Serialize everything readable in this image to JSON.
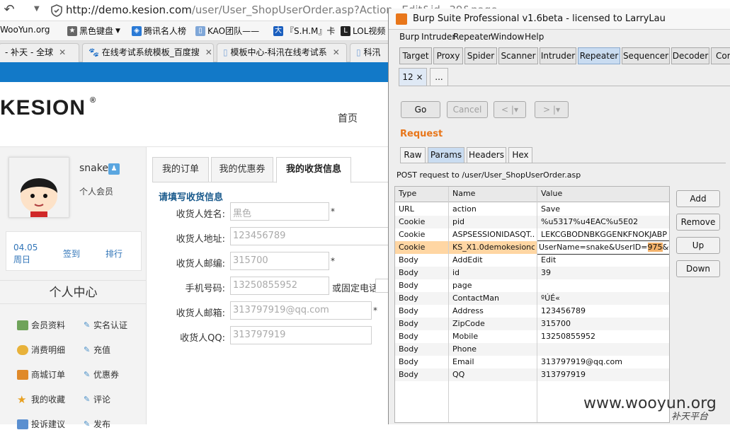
{
  "browser": {
    "url_host": "http://demo.kesion.com",
    "url_path": "/user/User_ShopUserOrder.asp?Action=Edit&id=39&page=",
    "bookmarks": [
      "WooYun.org",
      "黑色键盘",
      "腾讯名人榜",
      "KAO团队——",
      "『S.H.M』卡",
      "LOL视频"
    ],
    "tabs": [
      "- 补天 - 全球",
      "在线考试系统模板_百度搜",
      "模板中心-科汛在线考试系",
      "科汛"
    ]
  },
  "site": {
    "logo": "KESION",
    "logo_mark": "®",
    "nav_home": "首页",
    "user": {
      "name": "snake",
      "role": "个人会员"
    },
    "date": {
      "day": "04.05",
      "weekday": "周日"
    },
    "signin": "签到",
    "rank": "排行",
    "center_title": "个人中心",
    "menu": [
      {
        "left": "会员资料",
        "right": "实名认证"
      },
      {
        "left": "消费明细",
        "right": "充值"
      },
      {
        "left": "商城订单",
        "right": "优惠券"
      },
      {
        "left": "我的收藏",
        "right": "评论"
      },
      {
        "left": "投诉建议",
        "right": "发布"
      }
    ],
    "tabs": [
      "我的订单",
      "我的优惠券",
      "我的收货信息"
    ],
    "form_title": "请填写收货信息",
    "fields": [
      {
        "label": "收货人姓名:",
        "value": "黑色",
        "required": "*"
      },
      {
        "label": "收货人地址:",
        "value": "123456789",
        "required": ""
      },
      {
        "label": "收货人邮编:",
        "value": "315700",
        "required": "*"
      },
      {
        "label": "手机号码:",
        "value": "13250855952",
        "required": ""
      },
      {
        "label": "收货人邮箱:",
        "value": "313797919@qq.com",
        "required": "*"
      },
      {
        "label": "收货人QQ:",
        "value": "313797919",
        "required": ""
      }
    ],
    "phone_alt": "或固定电话"
  },
  "burp": {
    "title": "Burp Suite Professional v1.6beta - licensed to LarryLau",
    "menu": [
      "Burp",
      "Intruder",
      "Repeater",
      "Window",
      "Help"
    ],
    "tool_tabs": [
      "Target",
      "Proxy",
      "Spider",
      "Scanner",
      "Intruder",
      "Repeater",
      "Sequencer",
      "Decoder",
      "Com"
    ],
    "sub_tabs": [
      "12 ×",
      "..."
    ],
    "buttons": {
      "go": "Go",
      "cancel": "Cancel",
      "prev": "< |▾",
      "next": "> |▾"
    },
    "request_label": "Request",
    "view_tabs": [
      "Raw",
      "Params",
      "Headers",
      "Hex"
    ],
    "post_line": "POST request to /user/User_ShopUserOrder.asp",
    "table_headers": [
      "Type",
      "Name",
      "Value"
    ],
    "rows": [
      {
        "type": "URL",
        "name": "action",
        "value": "Save"
      },
      {
        "type": "Cookie",
        "name": "pid",
        "value": "%u5317%u4EAC%u5E02"
      },
      {
        "type": "Cookie",
        "name": "ASPSESSIONIDASQT...",
        "value": "LEKCGBODNBKGGENKFNOKJABP"
      },
      {
        "type": "Cookie",
        "name": "KS_X1.0demokesionc...",
        "value": ""
      },
      {
        "type": "Body",
        "name": "AddEdit",
        "value": "Edit"
      },
      {
        "type": "Body",
        "name": "id",
        "value": "39"
      },
      {
        "type": "Body",
        "name": "page",
        "value": ""
      },
      {
        "type": "Body",
        "name": "ContactMan",
        "value": "ºÚÉ«"
      },
      {
        "type": "Body",
        "name": "Address",
        "value": "123456789"
      },
      {
        "type": "Body",
        "name": "ZipCode",
        "value": "315700"
      },
      {
        "type": "Body",
        "name": "Mobile",
        "value": "13250855952"
      },
      {
        "type": "Body",
        "name": "Phone",
        "value": ""
      },
      {
        "type": "Body",
        "name": "Email",
        "value": "313797919@qq.com"
      },
      {
        "type": "Body",
        "name": "QQ",
        "value": "313797919"
      }
    ],
    "edit_value": {
      "pre": "UserName=snake&UserID=",
      "hl": "975",
      "post": "&Group"
    },
    "side_buttons": [
      "Add",
      "Remove",
      "Up",
      "Down"
    ]
  },
  "watermark": {
    "main": "www.wooyun.org",
    "sub": "补天平台"
  }
}
